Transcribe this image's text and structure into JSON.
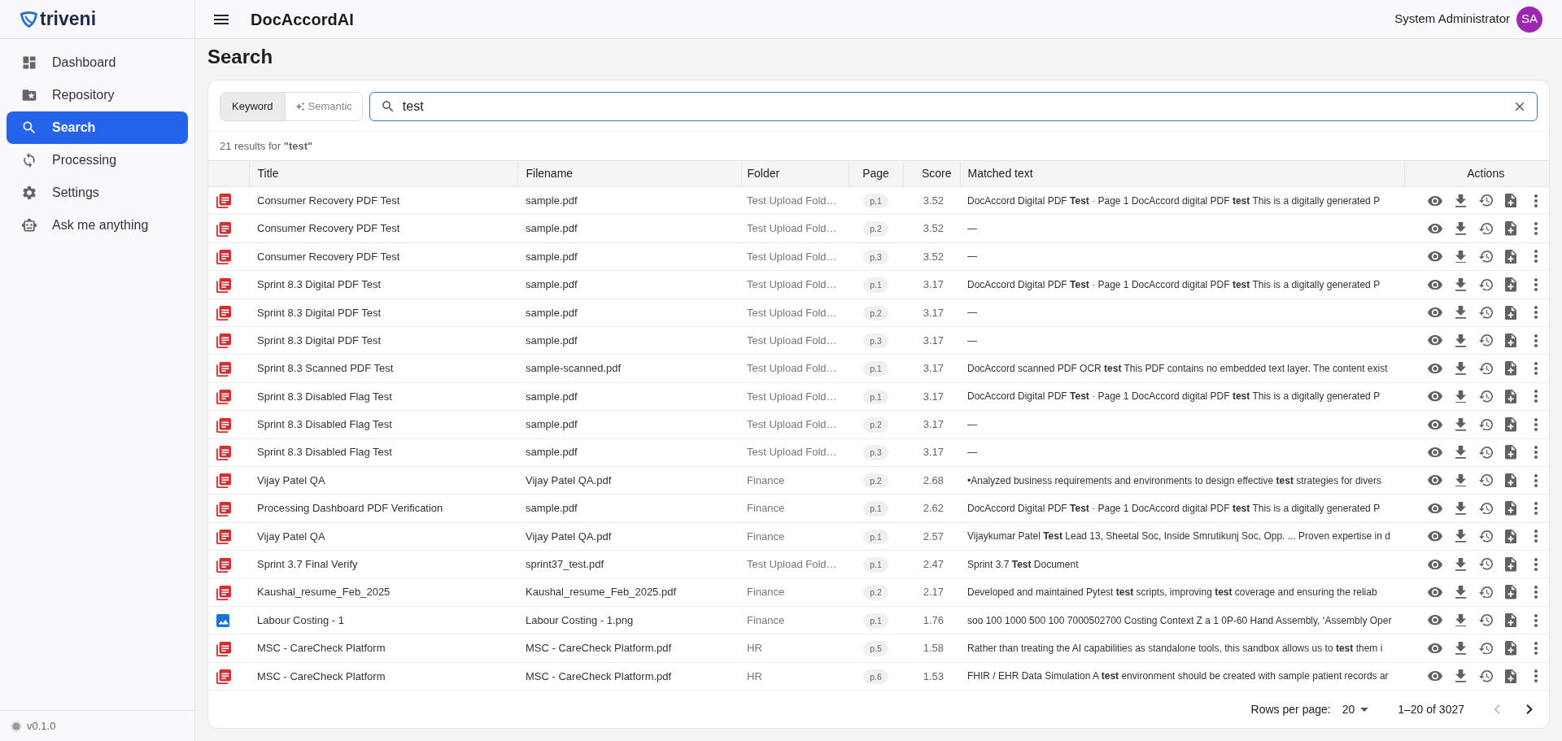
{
  "sidebar": {
    "brand": "triveni",
    "items": [
      {
        "label": "Dashboard",
        "selected": false
      },
      {
        "label": "Repository",
        "selected": false
      },
      {
        "label": "Search",
        "selected": true
      },
      {
        "label": "Processing",
        "selected": false
      },
      {
        "label": "Settings",
        "selected": false
      },
      {
        "label": "Ask me anything",
        "selected": false
      }
    ],
    "version": "v0.1.0"
  },
  "topbar": {
    "title": "DocAccordAI",
    "user": "System Administrator",
    "avatar": "SA"
  },
  "page": {
    "title": "Search"
  },
  "search": {
    "modes": [
      {
        "label": "Keyword",
        "selected": true
      },
      {
        "label": "Semantic",
        "selected": false
      }
    ],
    "value": "test"
  },
  "results_summary": "21 results for **\"test\"**",
  "table": {
    "columns": [
      "Title",
      "Filename",
      "Folder",
      "Page",
      "Score",
      "Matched text",
      "Actions"
    ],
    "rows": [
      {
        "kind": "pdf",
        "title": "Consumer Recovery PDF Test",
        "filename": "sample.pdf",
        "folder": "Test Upload Fold…",
        "page": "p.1",
        "score": "3.52",
        "matched_text": "DocAccord Digital PDF **Test** · Page 1 DocAccord digital PDF **test** This is a digitally generated P"
      },
      {
        "kind": "pdf",
        "title": "Consumer Recovery PDF Test",
        "filename": "sample.pdf",
        "folder": "Test Upload Fold…",
        "page": "p.2",
        "score": "3.52",
        "matched_text": "—"
      },
      {
        "kind": "pdf",
        "title": "Consumer Recovery PDF Test",
        "filename": "sample.pdf",
        "folder": "Test Upload Fold…",
        "page": "p.3",
        "score": "3.52",
        "matched_text": "—"
      },
      {
        "kind": "pdf",
        "title": "Sprint 8.3 Digital PDF Test",
        "filename": "sample.pdf",
        "folder": "Test Upload Fold…",
        "page": "p.1",
        "score": "3.17",
        "matched_text": "DocAccord Digital PDF **Test** · Page 1 DocAccord digital PDF **test** This is a digitally generated P"
      },
      {
        "kind": "pdf",
        "title": "Sprint 8.3 Digital PDF Test",
        "filename": "sample.pdf",
        "folder": "Test Upload Fold…",
        "page": "p.2",
        "score": "3.17",
        "matched_text": "—"
      },
      {
        "kind": "pdf",
        "title": "Sprint 8.3 Digital PDF Test",
        "filename": "sample.pdf",
        "folder": "Test Upload Fold…",
        "page": "p.3",
        "score": "3.17",
        "matched_text": "—"
      },
      {
        "kind": "pdf",
        "title": "Sprint 8.3 Scanned PDF Test",
        "filename": "sample-scanned.pdf",
        "folder": "Test Upload Fold…",
        "page": "p.1",
        "score": "3.17",
        "matched_text": "DocAccord scanned PDF OCR **test** This PDF contains no embedded text layer. The content exist"
      },
      {
        "kind": "pdf",
        "title": "Sprint 8.3 Disabled Flag Test",
        "filename": "sample.pdf",
        "folder": "Test Upload Fold…",
        "page": "p.1",
        "score": "3.17",
        "matched_text": "DocAccord Digital PDF **Test** · Page 1 DocAccord digital PDF **test** This is a digitally generated P"
      },
      {
        "kind": "pdf",
        "title": "Sprint 8.3 Disabled Flag Test",
        "filename": "sample.pdf",
        "folder": "Test Upload Fold…",
        "page": "p.2",
        "score": "3.17",
        "matched_text": "—"
      },
      {
        "kind": "pdf",
        "title": "Sprint 8.3 Disabled Flag Test",
        "filename": "sample.pdf",
        "folder": "Test Upload Fold…",
        "page": "p.3",
        "score": "3.17",
        "matched_text": "—"
      },
      {
        "kind": "pdf",
        "title": "Vijay Patel QA",
        "filename": "Vijay Patel QA.pdf",
        "folder": "Finance",
        "page": "p.2",
        "score": "2.68",
        "matched_text": "•Analyzed business requirements and environments to design effective **test** strategies for divers"
      },
      {
        "kind": "pdf",
        "title": "Processing Dashboard PDF Verification",
        "filename": "sample.pdf",
        "folder": "Finance",
        "page": "p.1",
        "score": "2.62",
        "matched_text": "DocAccord Digital PDF **Test** · Page 1 DocAccord digital PDF **test** This is a digitally generated P"
      },
      {
        "kind": "pdf",
        "title": "Vijay Patel QA",
        "filename": "Vijay Patel QA.pdf",
        "folder": "Finance",
        "page": "p.1",
        "score": "2.57",
        "matched_text": "Vijaykumar Patel **Test** Lead 13, Sheetal Soc, Inside Smrutikunj Soc, Opp. ... Proven expertise in d"
      },
      {
        "kind": "pdf",
        "title": "Sprint 3.7 Final Verify",
        "filename": "sprint37_test.pdf",
        "folder": "Test Upload Fold…",
        "page": "p.1",
        "score": "2.47",
        "matched_text": "Sprint 3.7 **Test** Document"
      },
      {
        "kind": "pdf",
        "title": "Kaushal_resume_Feb_2025",
        "filename": "Kaushal_resume_Feb_2025.pdf",
        "folder": "Finance",
        "page": "p.2",
        "score": "2.17",
        "matched_text": "Developed and maintained Pytest **test** scripts, improving **test** coverage and ensuring the reliab"
      },
      {
        "kind": "image",
        "title": "Labour Costing - 1",
        "filename": "Labour Costing - 1.png",
        "folder": "Finance",
        "page": "p.1",
        "score": "1.76",
        "matched_text": "soo 100 1000 500 100 7000502700 Costing Context Z a 1 0P-60 Hand Assembly, ‘Assembly Oper"
      },
      {
        "kind": "pdf",
        "title": "MSC - CareCheck Platform",
        "filename": "MSC - CareCheck Platform.pdf",
        "folder": "HR",
        "page": "p.5",
        "score": "1.58",
        "matched_text": "Rather than treating the AI capabilities as standalone tools, this sandbox allows us to **test** them i"
      },
      {
        "kind": "pdf",
        "title": "MSC - CareCheck Platform",
        "filename": "MSC - CareCheck Platform.pdf",
        "folder": "HR",
        "page": "p.6",
        "score": "1.53",
        "matched_text": "FHIR / EHR Data Simulation A **test** environment should be created with sample patient records ar"
      }
    ]
  },
  "pagination": {
    "rows_per_page_label": "Rows per page:",
    "rows_per_page": "20",
    "range": "1–20 of 3027",
    "prev": {
      "disabled": true
    },
    "next": {
      "disabled": false
    }
  }
}
